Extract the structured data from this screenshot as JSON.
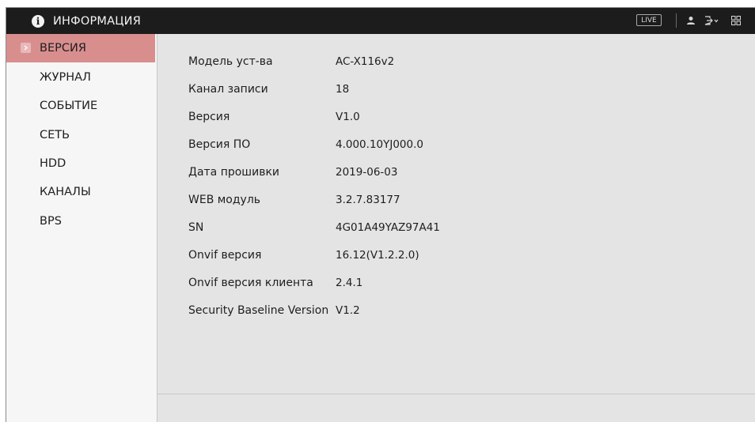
{
  "header": {
    "title": "ИНФОРМАЦИЯ",
    "live_label": "LIVE",
    "icons": [
      "info-icon",
      "user-icon",
      "logout-icon",
      "grid-icon"
    ]
  },
  "sidebar": {
    "items": [
      {
        "label": "ВЕРСИЯ",
        "active": true
      },
      {
        "label": "ЖУРНАЛ",
        "active": false
      },
      {
        "label": "СОБЫТИЕ",
        "active": false
      },
      {
        "label": "СЕТЬ",
        "active": false
      },
      {
        "label": "HDD",
        "active": false
      },
      {
        "label": "КАНАЛЫ",
        "active": false
      },
      {
        "label": "BPS",
        "active": false
      }
    ]
  },
  "version_info": {
    "rows": [
      {
        "label": "Модель уст-ва",
        "value": "AC-X116v2"
      },
      {
        "label": "Канал записи",
        "value": "18"
      },
      {
        "label": "Версия",
        "value": "V1.0"
      },
      {
        "label": "Версия ПО",
        "value": "4.000.10YJ000.0"
      },
      {
        "label": "Дата прошивки",
        "value": "2019-06-03"
      },
      {
        "label": "WEB модуль",
        "value": "3.2.7.83177"
      },
      {
        "label": "SN",
        "value": "4G01A49YAZ97A41"
      },
      {
        "label": "Onvif версия",
        "value": "16.12(V1.2.2.0)"
      },
      {
        "label": "Onvif версия клиента",
        "value": "2.4.1"
      },
      {
        "label": "Security Baseline Version",
        "value": "V1.2"
      }
    ]
  },
  "colors": {
    "topbar": "#1c1c1c",
    "active_item": "#d98e8e",
    "background": "#e4e4e4",
    "sidebar": "#f6f6f6"
  }
}
